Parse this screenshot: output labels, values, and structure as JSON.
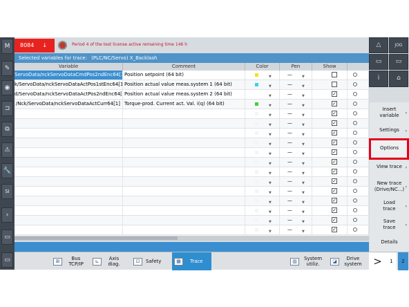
{
  "alarm": {
    "number": "8084",
    "ack_symbol": "↓",
    "message": "Period 4 of the test license active remaining time 146 h"
  },
  "header": {
    "label": "Selected variables for trace:",
    "trace_name": "(PLC/NC/Servo) X_Backlash"
  },
  "columns": [
    "Variable",
    "Comment",
    "Color",
    "Pen",
    "Show"
  ],
  "rows": [
    {
      "variable": "ServoData/nckServoDataCmdPos2ndEnc64[1]",
      "comment": "Position setpoint (64 bit)",
      "color": "#f2e21e",
      "pen": "—",
      "show": "",
      "selected": true
    },
    {
      "variable": "k/ServoData/nckServoDataActPos1stEnc64[1]",
      "comment": "Position actual value meas.system 1 (64 bit)",
      "color": "#35d6e8",
      "pen": "—",
      "show": ""
    },
    {
      "variable": "d/ServoData/nckServoDataActPos2ndEnc64[1]",
      "comment": "Position actual value meas.system 2 (64 bit)",
      "color": "#ffffff",
      "pen": "—",
      "show": "✓"
    },
    {
      "variable": "/Nck/ServoData/nckServoDataActCurr64[1]",
      "comment": "Torque-prod. Current act. Val. i(q) (64 bit)",
      "color": "#3fcf3f",
      "pen": "—",
      "show": "✓"
    },
    {
      "variable": "",
      "comment": "",
      "color": "#f4f4f4",
      "pen": "—",
      "show": "✓"
    },
    {
      "variable": "",
      "comment": "",
      "color": "#f4f4f4",
      "pen": "—",
      "show": "✓"
    },
    {
      "variable": "",
      "comment": "",
      "color": "#f4f4f4",
      "pen": "—",
      "show": "✓"
    },
    {
      "variable": "",
      "comment": "",
      "color": "#f4f4f4",
      "pen": "—",
      "show": "✓"
    },
    {
      "variable": "",
      "comment": "",
      "color": "#f4f4f4",
      "pen": "—",
      "show": "✓"
    },
    {
      "variable": "",
      "comment": "",
      "color": "#f4f4f4",
      "pen": "—",
      "show": "✓"
    },
    {
      "variable": "",
      "comment": "",
      "color": "#f4f4f4",
      "pen": "—",
      "show": "✓"
    },
    {
      "variable": "",
      "comment": "",
      "color": "#f4f4f4",
      "pen": "—",
      "show": "✓"
    },
    {
      "variable": "",
      "comment": "",
      "color": "#f4f4f4",
      "pen": "—",
      "show": "✓"
    },
    {
      "variable": "",
      "comment": "",
      "color": "#f4f4f4",
      "pen": "—",
      "show": "✓"
    },
    {
      "variable": "",
      "comment": "",
      "color": "#f4f4f4",
      "pen": "—",
      "show": "✓"
    },
    {
      "variable": "",
      "comment": "",
      "color": "#f4f4f4",
      "pen": "—",
      "show": "✓"
    },
    {
      "variable": "",
      "comment": "",
      "color": "#f4f4f4",
      "pen": "—",
      "show": "✓"
    }
  ],
  "softkeys": [
    {
      "label": "Insert variable",
      "arrow": "›"
    },
    {
      "label": "Settings",
      "arrow": "›"
    },
    {
      "label": "Options",
      "arrow": ""
    },
    {
      "label": "View trace",
      "arrow": "›"
    },
    {
      "label": "New trace (Drive/NC...)",
      "arrow": "›"
    },
    {
      "label": "Load trace",
      "arrow": "›"
    },
    {
      "label": "Save trace",
      "arrow": "›"
    },
    {
      "label": "Details",
      "arrow": ""
    }
  ],
  "bottom_keys": {
    "bus": "Bus TCP/IP",
    "axis": "Axis diag.",
    "safety": "Safety",
    "trace": "Trace",
    "system": "System utiliz.",
    "drive": "Drive system",
    "next": ">",
    "page1": "1",
    "page2": "2"
  },
  "icons": {
    "right_top": [
      "mountain-icon",
      "grid-icon",
      "panel-icon",
      "panel-icon",
      "info-icon",
      "camera-icon"
    ],
    "right_top_labels": [
      "△",
      "JOG",
      "▭",
      "▭",
      "i",
      "⌂"
    ],
    "left": [
      "machine-icon",
      "parameter-icon",
      "program-icon",
      "program-manager-icon",
      "diagnostics-icon",
      "warning-icon",
      "tool-icon",
      "sinumerik-icon",
      "expand-icon",
      "window-icon",
      "window-icon"
    ],
    "left_labels": [
      "M",
      "✎",
      "◉",
      "⊐",
      "⧉",
      "⚠",
      "🔧",
      "SI",
      "›",
      "▭",
      "▭"
    ]
  }
}
